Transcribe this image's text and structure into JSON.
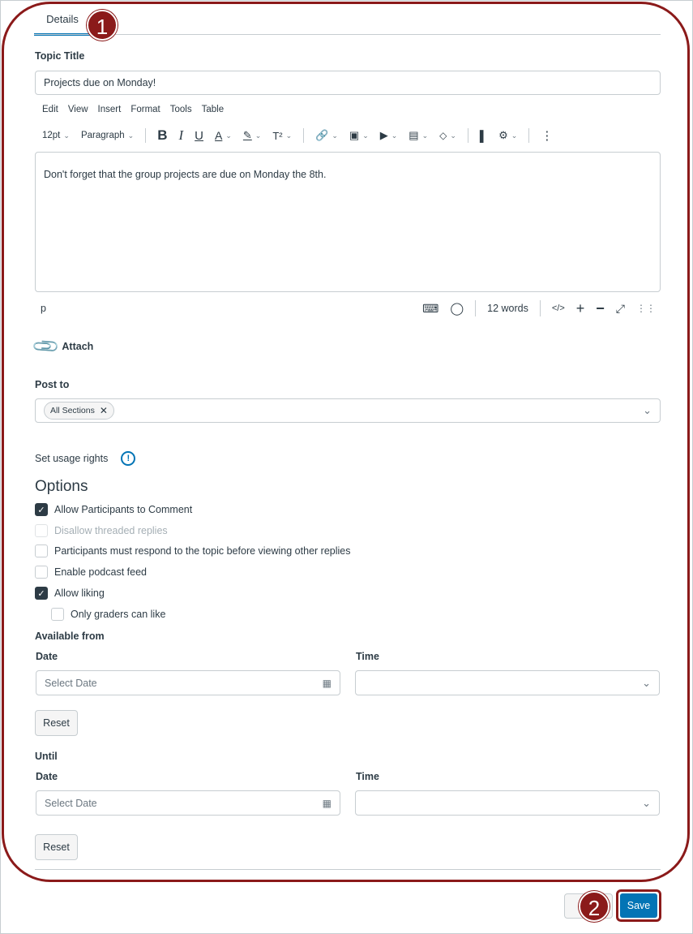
{
  "tabs": {
    "details": "Details"
  },
  "badges": {
    "one": "1",
    "two": "2"
  },
  "topic": {
    "label": "Topic Title",
    "value": "Projects due on Monday!"
  },
  "editor": {
    "menu": [
      "Edit",
      "View",
      "Insert",
      "Format",
      "Tools",
      "Table"
    ],
    "font_size": "12pt",
    "block_format": "Paragraph",
    "content": "Don't forget that the group projects are due on Monday the 8th.",
    "path": "p",
    "word_count": "12 words",
    "html_toggle": "</>"
  },
  "attach": {
    "label": "Attach"
  },
  "post_to": {
    "label": "Post to",
    "chip": "All Sections"
  },
  "usage_rights": {
    "label": "Set usage rights"
  },
  "options": {
    "heading": "Options",
    "allow_comment": "Allow Participants to Comment",
    "disallow_threaded": "Disallow threaded replies",
    "must_respond": "Participants must respond to the topic before viewing other replies",
    "podcast": "Enable podcast feed",
    "allow_liking": "Allow liking",
    "graders_like": "Only graders can like"
  },
  "available_from": {
    "heading": "Available from",
    "date_label": "Date",
    "time_label": "Time",
    "date_placeholder": "Select Date",
    "reset": "Reset"
  },
  "until": {
    "heading": "Until",
    "date_label": "Date",
    "time_label": "Time",
    "date_placeholder": "Select Date",
    "reset": "Reset"
  },
  "footer": {
    "save": "Save"
  },
  "colors": {
    "accent": "#0374b5",
    "annotation": "#8b1a1a",
    "text": "#2d3b45"
  }
}
